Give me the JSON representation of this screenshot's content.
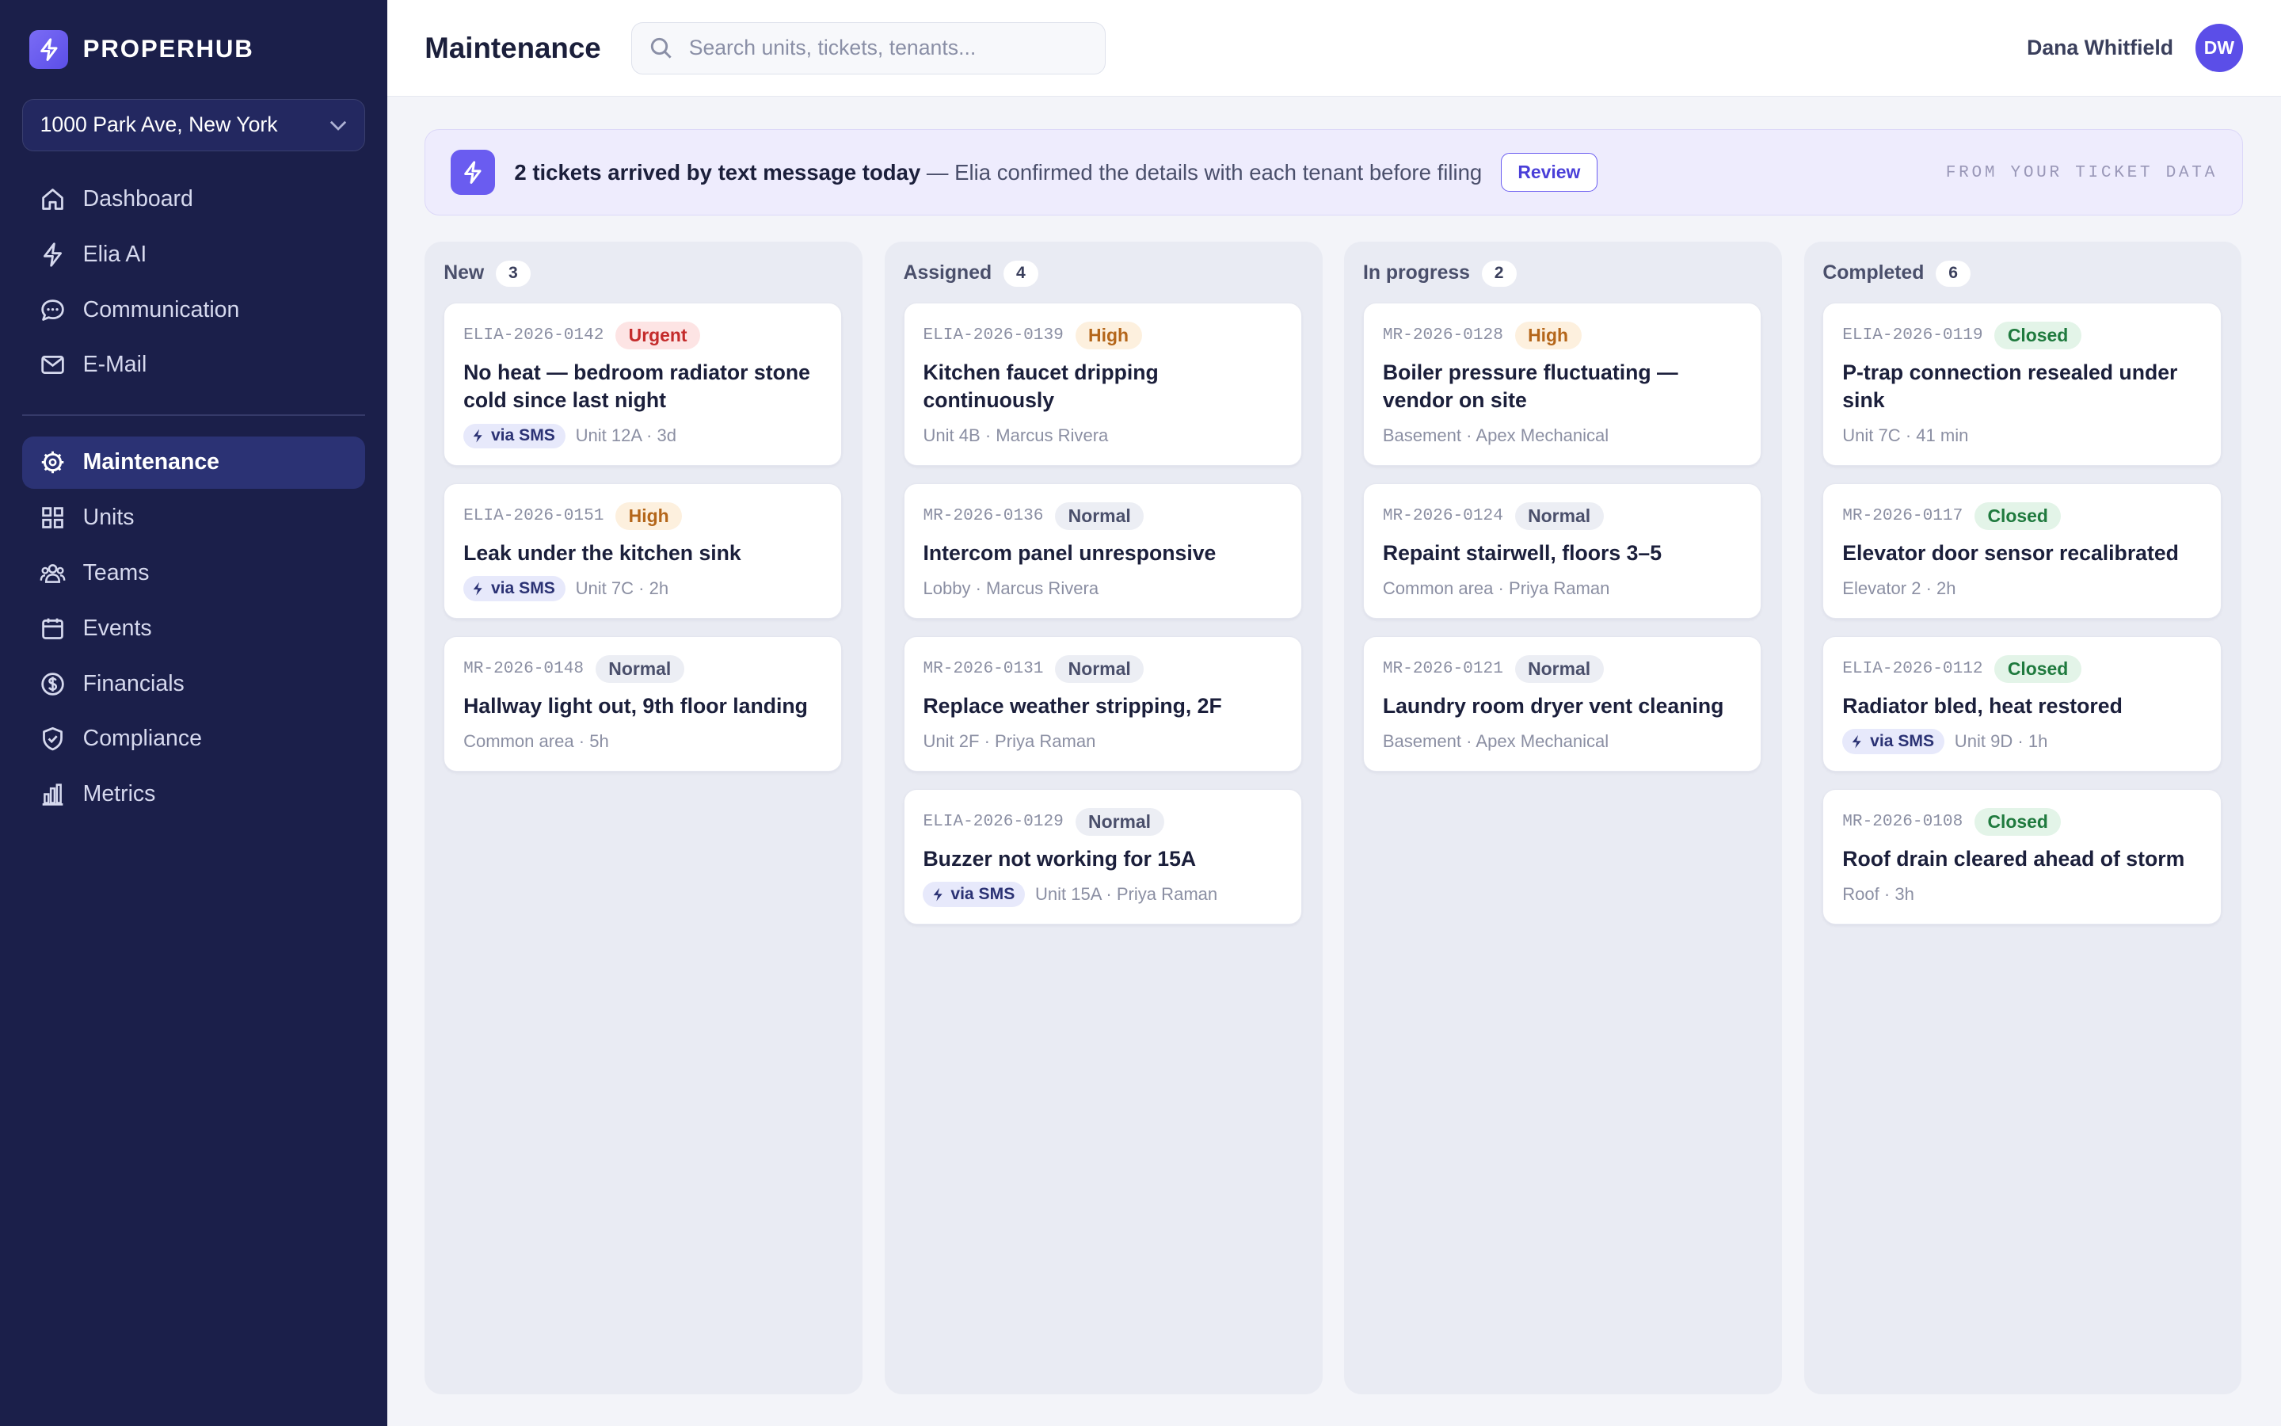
{
  "app": {
    "name": "PROPERHUB"
  },
  "property": {
    "selected": "1000 Park Ave, New York"
  },
  "nav": {
    "primary": [
      {
        "label": "Dashboard",
        "icon": "home-icon"
      },
      {
        "label": "Elia AI",
        "icon": "bolt-icon"
      },
      {
        "label": "Communication",
        "icon": "chat-icon"
      },
      {
        "label": "E-Mail",
        "icon": "mail-icon"
      }
    ],
    "secondary": [
      {
        "label": "Maintenance",
        "icon": "gear-icon",
        "active": true
      },
      {
        "label": "Units",
        "icon": "grid-icon"
      },
      {
        "label": "Teams",
        "icon": "users-icon"
      },
      {
        "label": "Events",
        "icon": "calendar-icon"
      },
      {
        "label": "Financials",
        "icon": "dollar-icon"
      },
      {
        "label": "Compliance",
        "icon": "shield-icon"
      },
      {
        "label": "Metrics",
        "icon": "bar-chart-icon"
      }
    ]
  },
  "header": {
    "title": "Maintenance",
    "search_placeholder": "Search units, tickets, tenants...",
    "user_name": "Dana Whitfield",
    "user_initials": "DW"
  },
  "banner": {
    "headline": "2 tickets arrived by text message today",
    "detail": " — Elia confirmed the details with each tenant before filing",
    "button": "Review",
    "tag": "FROM YOUR TICKET DATA"
  },
  "columns": [
    {
      "title": "New",
      "count": "3",
      "cards": [
        {
          "id": "ELIA-2026-0142",
          "priority": "Urgent",
          "title": "No heat — bedroom radiator stone cold since last night",
          "sms": "via SMS",
          "meta": "Unit 12A · 3d"
        },
        {
          "id": "ELIA-2026-0151",
          "priority": "High",
          "title": "Leak under the kitchen sink",
          "sms": "via SMS",
          "meta": "Unit 7C · 2h"
        },
        {
          "id": "MR-2026-0148",
          "priority": "Normal",
          "title": "Hallway light out, 9th floor landing",
          "meta": "Common area · 5h"
        }
      ]
    },
    {
      "title": "Assigned",
      "count": "4",
      "cards": [
        {
          "id": "ELIA-2026-0139",
          "priority": "High",
          "title": "Kitchen faucet dripping continuously",
          "meta": "Unit 4B · Marcus Rivera"
        },
        {
          "id": "MR-2026-0136",
          "priority": "Normal",
          "title": "Intercom panel unresponsive",
          "meta": "Lobby · Marcus Rivera"
        },
        {
          "id": "MR-2026-0131",
          "priority": "Normal",
          "title": "Replace weather stripping, 2F",
          "meta": "Unit 2F · Priya Raman"
        },
        {
          "id": "ELIA-2026-0129",
          "priority": "Normal",
          "title": "Buzzer not working for 15A",
          "sms": "via SMS",
          "meta": "Unit 15A · Priya Raman"
        }
      ]
    },
    {
      "title": "In progress",
      "count": "2",
      "cards": [
        {
          "id": "MR-2026-0128",
          "priority": "High",
          "title": "Boiler pressure fluctuating — vendor on site",
          "meta": "Basement · Apex Mechanical"
        },
        {
          "id": "MR-2026-0124",
          "priority": "Normal",
          "title": "Repaint stairwell, floors 3–5",
          "meta": "Common area · Priya Raman"
        },
        {
          "id": "MR-2026-0121",
          "priority": "Normal",
          "title": "Laundry room dryer vent cleaning",
          "meta": "Basement · Apex Mechanical"
        }
      ]
    },
    {
      "title": "Completed",
      "count": "6",
      "cards": [
        {
          "id": "ELIA-2026-0119",
          "priority": "Closed",
          "title": "P-trap connection resealed under sink",
          "meta": "Unit 7C · 41 min"
        },
        {
          "id": "MR-2026-0117",
          "priority": "Closed",
          "title": "Elevator door sensor recalibrated",
          "meta": "Elevator 2 · 2h"
        },
        {
          "id": "ELIA-2026-0112",
          "priority": "Closed",
          "title": "Radiator bled, heat restored",
          "sms": "via SMS",
          "meta": "Unit 9D · 1h"
        },
        {
          "id": "MR-2026-0108",
          "priority": "Closed",
          "title": "Roof drain cleared ahead of storm",
          "meta": "Roof · 3h"
        }
      ]
    }
  ],
  "colors": {
    "sidebar": "#1b1f4a",
    "accent": "#6a5cf0",
    "urgent": "#c42b2b",
    "high": "#b4661a",
    "closed": "#1f7a3e"
  }
}
